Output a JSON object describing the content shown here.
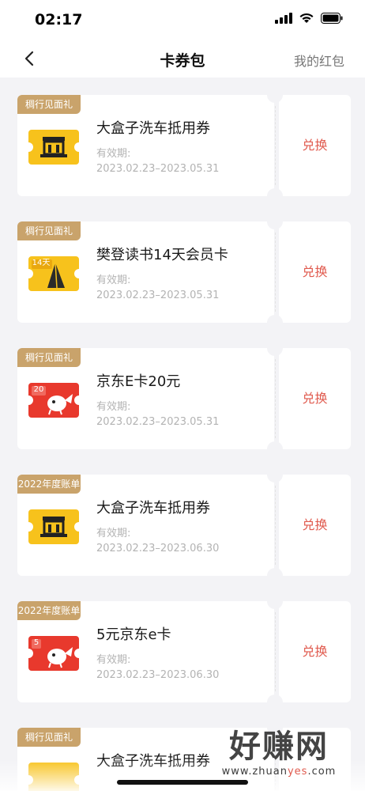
{
  "status": {
    "time": "02:17"
  },
  "nav": {
    "title": "卡券包",
    "right_link": "我的红包"
  },
  "coupons": [
    {
      "tag": "稠行见面礼",
      "title": "大盒子洗车抵用券",
      "valid_label": "有效期:",
      "valid_range": "2023.02.23–2023.05.31",
      "action": "兑换",
      "icon": "car-wash-coupon-icon",
      "icon_badge": ""
    },
    {
      "tag": "稠行见面礼",
      "title": "樊登读书14天会员卡",
      "valid_label": "有效期:",
      "valid_range": "2023.02.23–2023.05.31",
      "action": "兑换",
      "icon": "book-membership-icon",
      "icon_badge": "14天"
    },
    {
      "tag": "稠行见面礼",
      "title": "京东E卡20元",
      "valid_label": "有效期:",
      "valid_range": "2023.02.23–2023.05.31",
      "action": "兑换",
      "icon": "jd-ecard-icon",
      "icon_badge": "20"
    },
    {
      "tag": "2022年度账单",
      "title": "大盒子洗车抵用券",
      "valid_label": "有效期:",
      "valid_range": "2023.02.23–2023.06.30",
      "action": "兑换",
      "icon": "car-wash-coupon-icon",
      "icon_badge": ""
    },
    {
      "tag": "2022年度账单",
      "title": "5元京东e卡",
      "valid_label": "有效期:",
      "valid_range": "2023.02.23–2023.06.30",
      "action": "兑换",
      "icon": "jd-ecard-icon",
      "icon_badge": "5"
    },
    {
      "tag": "稠行见面礼",
      "title": "大盒子洗车抵用券",
      "valid_label": "",
      "valid_range": "",
      "action": "",
      "icon": "car-wash-coupon-icon",
      "icon_badge": ""
    }
  ],
  "watermark": {
    "main": "好赚网",
    "url_pre": "www.zhuan",
    "url_mid": "yes",
    "url_post": ".com"
  },
  "colors": {
    "tag_bg": "#c9a36b",
    "action": "#e05a4e",
    "yellow": "#f7c21c",
    "jd_red": "#e8392d"
  }
}
